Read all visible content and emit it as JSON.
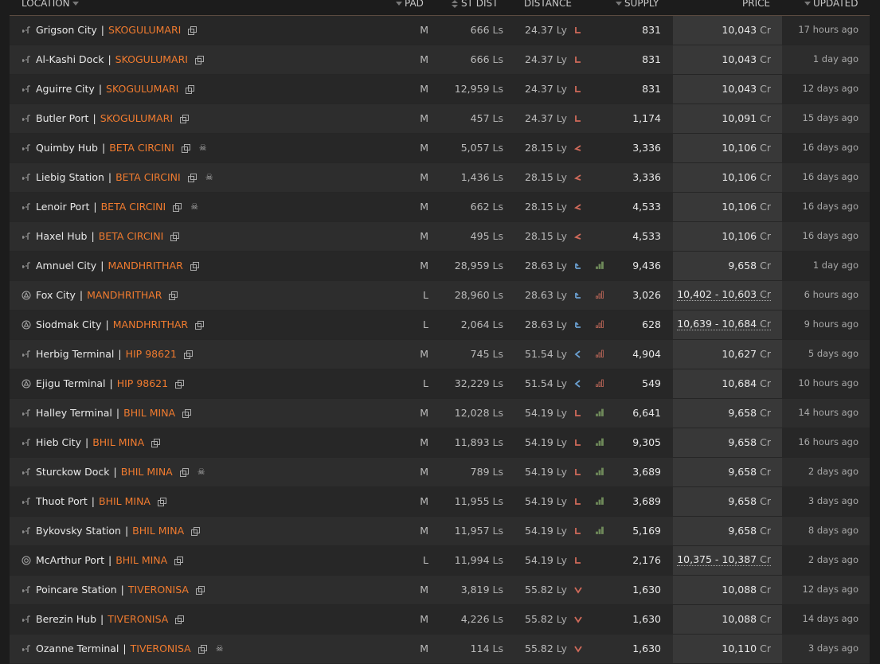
{
  "header": {
    "location": "LOCATION",
    "pad": "PAD",
    "st_dist": "ST DIST",
    "distance": "DISTANCE",
    "supply": "SUPPLY",
    "price": "PRICE",
    "updated": "UPDATED"
  },
  "units": {
    "ls": "Ls",
    "ly": "Ly",
    "cr": "Cr"
  },
  "colors": {
    "system": "#f07b2f",
    "arrow_red": "#d06a5a",
    "arrow_blue": "#6a9fd0",
    "bars_green": "#6f8a5a",
    "bars_red": "#c46a5a"
  },
  "rows": [
    {
      "station": "Grigson City",
      "sep": "|",
      "system": "SKOGULUMARI",
      "icon": "outpost-icon",
      "skull": false,
      "pad": "M",
      "st_dist": "666",
      "distance": "24.37",
      "arrow": "down-left",
      "arrow_color": "red",
      "bars": "",
      "supply": "831",
      "price": "10,043",
      "updated": "17 hours ago"
    },
    {
      "station": "Al-Kashi Dock",
      "sep": "|",
      "system": "SKOGULUMARI",
      "icon": "outpost-icon",
      "skull": false,
      "pad": "M",
      "st_dist": "666",
      "distance": "24.37",
      "arrow": "down-left",
      "arrow_color": "red",
      "bars": "",
      "supply": "831",
      "price": "10,043",
      "updated": "1 day ago"
    },
    {
      "station": "Aguirre City",
      "sep": "|",
      "system": "SKOGULUMARI",
      "icon": "outpost-icon",
      "skull": false,
      "pad": "M",
      "st_dist": "12,959",
      "distance": "24.37",
      "arrow": "down-left",
      "arrow_color": "red",
      "bars": "",
      "supply": "831",
      "price": "10,043",
      "updated": "12 days ago"
    },
    {
      "station": "Butler Port",
      "sep": "|",
      "system": "SKOGULUMARI",
      "icon": "outpost-icon",
      "skull": false,
      "pad": "M",
      "st_dist": "457",
      "distance": "24.37",
      "arrow": "down-left",
      "arrow_color": "red",
      "bars": "",
      "supply": "1,174",
      "price": "10,091",
      "updated": "15 days ago"
    },
    {
      "station": "Quimby Hub",
      "sep": "|",
      "system": "BETA CIRCINI",
      "icon": "outpost-icon",
      "skull": true,
      "pad": "M",
      "st_dist": "5,057",
      "distance": "28.15",
      "arrow": "left-down",
      "arrow_color": "red",
      "bars": "",
      "supply": "3,336",
      "price": "10,106",
      "updated": "16 days ago"
    },
    {
      "station": "Liebig Station",
      "sep": "|",
      "system": "BETA CIRCINI",
      "icon": "outpost-icon",
      "skull": true,
      "pad": "M",
      "st_dist": "1,436",
      "distance": "28.15",
      "arrow": "left-down",
      "arrow_color": "red",
      "bars": "",
      "supply": "3,336",
      "price": "10,106",
      "updated": "16 days ago"
    },
    {
      "station": "Lenoir Port",
      "sep": "|",
      "system": "BETA CIRCINI",
      "icon": "outpost-icon",
      "skull": true,
      "pad": "M",
      "st_dist": "662",
      "distance": "28.15",
      "arrow": "left-down",
      "arrow_color": "red",
      "bars": "",
      "supply": "4,533",
      "price": "10,106",
      "updated": "16 days ago"
    },
    {
      "station": "Haxel Hub",
      "sep": "|",
      "system": "BETA CIRCINI",
      "icon": "outpost-icon",
      "skull": false,
      "pad": "M",
      "st_dist": "495",
      "distance": "28.15",
      "arrow": "left-down",
      "arrow_color": "red",
      "bars": "",
      "supply": "4,533",
      "price": "10,106",
      "updated": "16 days ago"
    },
    {
      "station": "Amnuel City",
      "sep": "|",
      "system": "MANDHRITHAR",
      "icon": "outpost-icon",
      "skull": false,
      "pad": "M",
      "st_dist": "28,959",
      "distance": "28.63",
      "arrow": "left-up",
      "arrow_color": "blue",
      "bars": "green",
      "supply": "9,436",
      "price": "9,658",
      "updated": "1 day ago"
    },
    {
      "station": "Fox City",
      "sep": "|",
      "system": "MANDHRITHAR",
      "icon": "starport-icon",
      "skull": false,
      "pad": "L",
      "st_dist": "28,960",
      "distance": "28.63",
      "arrow": "left-up",
      "arrow_color": "blue",
      "bars": "red",
      "supply": "3,026",
      "price": "10,402 - 10,603",
      "price_range": true,
      "updated": "6 hours ago"
    },
    {
      "station": "Siodmak City",
      "sep": "|",
      "system": "MANDHRITHAR",
      "icon": "starport-icon",
      "skull": false,
      "pad": "L",
      "st_dist": "2,064",
      "distance": "28.63",
      "arrow": "left-up",
      "arrow_color": "blue",
      "bars": "red",
      "supply": "628",
      "price": "10,639 - 10,684",
      "price_range": true,
      "updated": "9 hours ago"
    },
    {
      "station": "Herbig Terminal",
      "sep": "|",
      "system": "HIP 98621",
      "icon": "outpost-icon",
      "skull": false,
      "pad": "M",
      "st_dist": "745",
      "distance": "51.54",
      "arrow": "left",
      "arrow_color": "blue",
      "bars": "red",
      "supply": "4,904",
      "price": "10,627",
      "updated": "5 days ago"
    },
    {
      "station": "Ejigu Terminal",
      "sep": "|",
      "system": "HIP 98621",
      "icon": "starport-icon",
      "skull": false,
      "pad": "L",
      "st_dist": "32,229",
      "distance": "51.54",
      "arrow": "left",
      "arrow_color": "blue",
      "bars": "red",
      "supply": "549",
      "price": "10,684",
      "updated": "10 hours ago"
    },
    {
      "station": "Halley Terminal",
      "sep": "|",
      "system": "BHIL MINA",
      "icon": "outpost-icon",
      "skull": false,
      "pad": "M",
      "st_dist": "12,028",
      "distance": "54.19",
      "arrow": "down-left",
      "arrow_color": "red",
      "bars": "green",
      "supply": "6,641",
      "price": "9,658",
      "updated": "14 hours ago"
    },
    {
      "station": "Hieb City",
      "sep": "|",
      "system": "BHIL MINA",
      "icon": "outpost-icon",
      "skull": false,
      "pad": "M",
      "st_dist": "11,893",
      "distance": "54.19",
      "arrow": "down-left",
      "arrow_color": "red",
      "bars": "green",
      "supply": "9,305",
      "price": "9,658",
      "updated": "16 hours ago"
    },
    {
      "station": "Sturckow Dock",
      "sep": "|",
      "system": "BHIL MINA",
      "icon": "outpost-icon",
      "skull": true,
      "pad": "M",
      "st_dist": "789",
      "distance": "54.19",
      "arrow": "down-left",
      "arrow_color": "red",
      "bars": "green",
      "supply": "3,689",
      "price": "9,658",
      "updated": "2 days ago"
    },
    {
      "station": "Thuot Port",
      "sep": "|",
      "system": "BHIL MINA",
      "icon": "outpost-icon",
      "skull": false,
      "pad": "M",
      "st_dist": "11,955",
      "distance": "54.19",
      "arrow": "down-left",
      "arrow_color": "red",
      "bars": "green",
      "supply": "3,689",
      "price": "9,658",
      "updated": "3 days ago"
    },
    {
      "station": "Bykovsky Station",
      "sep": "|",
      "system": "BHIL MINA",
      "icon": "outpost-icon",
      "skull": false,
      "pad": "M",
      "st_dist": "11,957",
      "distance": "54.19",
      "arrow": "down-left",
      "arrow_color": "red",
      "bars": "green",
      "supply": "5,169",
      "price": "9,658",
      "updated": "8 days ago"
    },
    {
      "station": "McArthur Port",
      "sep": "|",
      "system": "BHIL MINA",
      "icon": "orbis-icon",
      "skull": false,
      "pad": "L",
      "st_dist": "11,994",
      "distance": "54.19",
      "arrow": "down-left",
      "arrow_color": "red",
      "bars": "",
      "supply": "2,176",
      "price": "10,375 - 10,387",
      "price_range": true,
      "updated": "2 days ago"
    },
    {
      "station": "Poincare Station",
      "sep": "|",
      "system": "TIVERONISA",
      "icon": "outpost-icon",
      "skull": false,
      "pad": "M",
      "st_dist": "3,819",
      "distance": "55.82",
      "arrow": "down",
      "arrow_color": "red",
      "bars": "",
      "supply": "1,630",
      "price": "10,088",
      "updated": "12 days ago"
    },
    {
      "station": "Berezin Hub",
      "sep": "|",
      "system": "TIVERONISA",
      "icon": "outpost-icon",
      "skull": false,
      "pad": "M",
      "st_dist": "4,226",
      "distance": "55.82",
      "arrow": "down",
      "arrow_color": "red",
      "bars": "",
      "supply": "1,630",
      "price": "10,088",
      "updated": "14 days ago"
    },
    {
      "station": "Ozanne Terminal",
      "sep": "|",
      "system": "TIVERONISA",
      "icon": "outpost-icon",
      "skull": true,
      "pad": "M",
      "st_dist": "114",
      "distance": "55.82",
      "arrow": "down",
      "arrow_color": "red",
      "bars": "",
      "supply": "1,630",
      "price": "10,110",
      "updated": "3 days ago"
    }
  ]
}
